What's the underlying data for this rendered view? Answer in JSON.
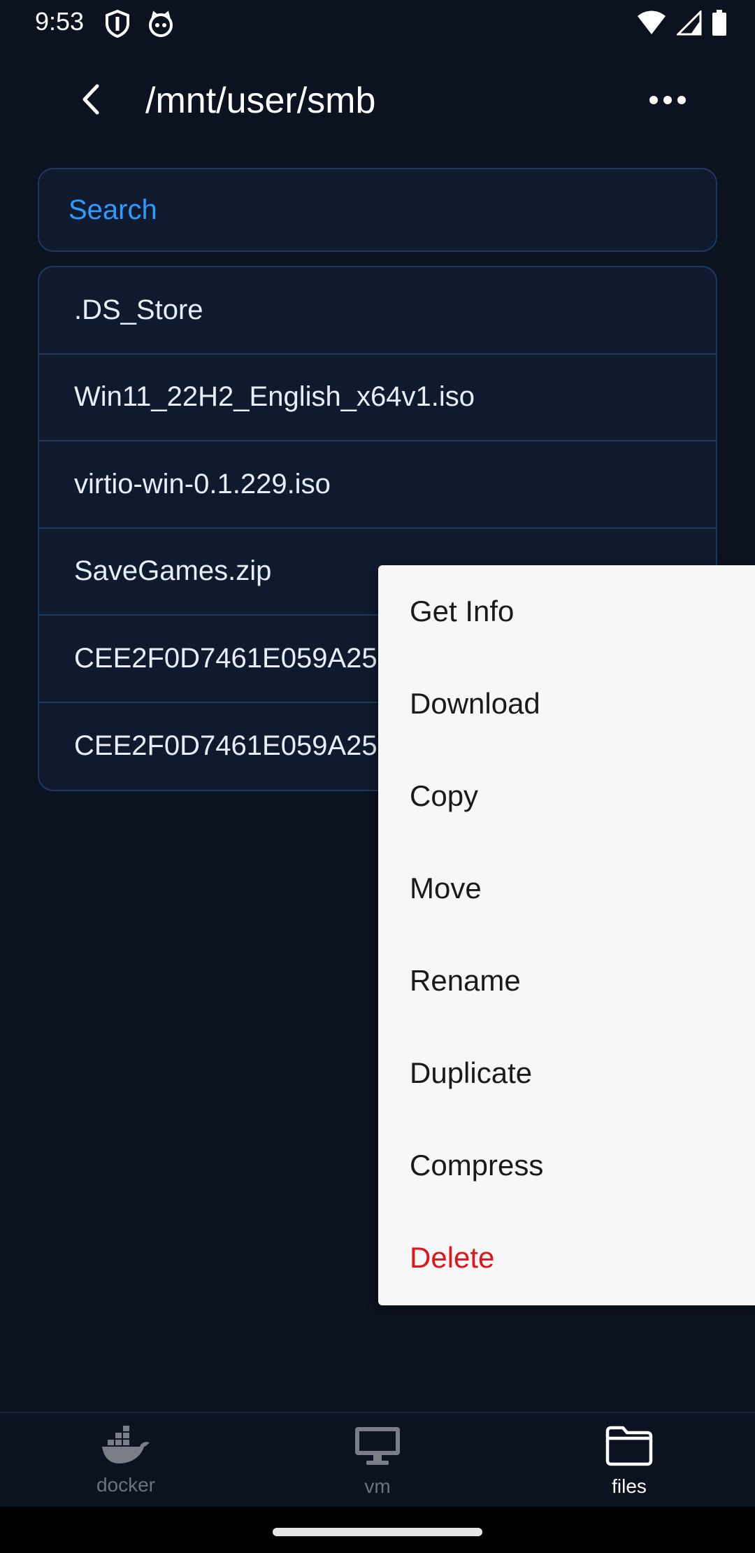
{
  "status_bar": {
    "time": "9:53",
    "left_icons": [
      "shield-icon",
      "cat-face-icon"
    ],
    "right_icons": [
      "wifi-icon",
      "cell-signal-icon",
      "battery-icon"
    ]
  },
  "header": {
    "title": "/mnt/user/smb",
    "back_icon": "chevron-left-icon",
    "more_icon": "more-horizontal-icon"
  },
  "search": {
    "placeholder": "Search"
  },
  "files": [
    {
      "name": ".DS_Store"
    },
    {
      "name": "Win11_22H2_English_x64v1.iso"
    },
    {
      "name": "virtio-win-0.1.229.iso"
    },
    {
      "name": "SaveGames.zip"
    },
    {
      "name": "CEE2F0D7461E059A25"
    },
    {
      "name": "CEE2F0D7461E059A25"
    }
  ],
  "context_menu": {
    "items": [
      {
        "label": "Get Info"
      },
      {
        "label": "Download"
      },
      {
        "label": "Copy"
      },
      {
        "label": "Move"
      },
      {
        "label": "Rename"
      },
      {
        "label": "Duplicate"
      },
      {
        "label": "Compress"
      },
      {
        "label": "Delete"
      }
    ],
    "danger_color": "#e0141b"
  },
  "bottom_nav": {
    "items": [
      {
        "label": "docker",
        "icon": "docker-whale-icon"
      },
      {
        "label": "vm",
        "icon": "monitor-icon"
      },
      {
        "label": "files",
        "icon": "folder-icon"
      }
    ],
    "active": "files"
  },
  "colors": {
    "background": "#0b1220",
    "accent": "#2e9bff",
    "border": "#1f3a5f"
  }
}
